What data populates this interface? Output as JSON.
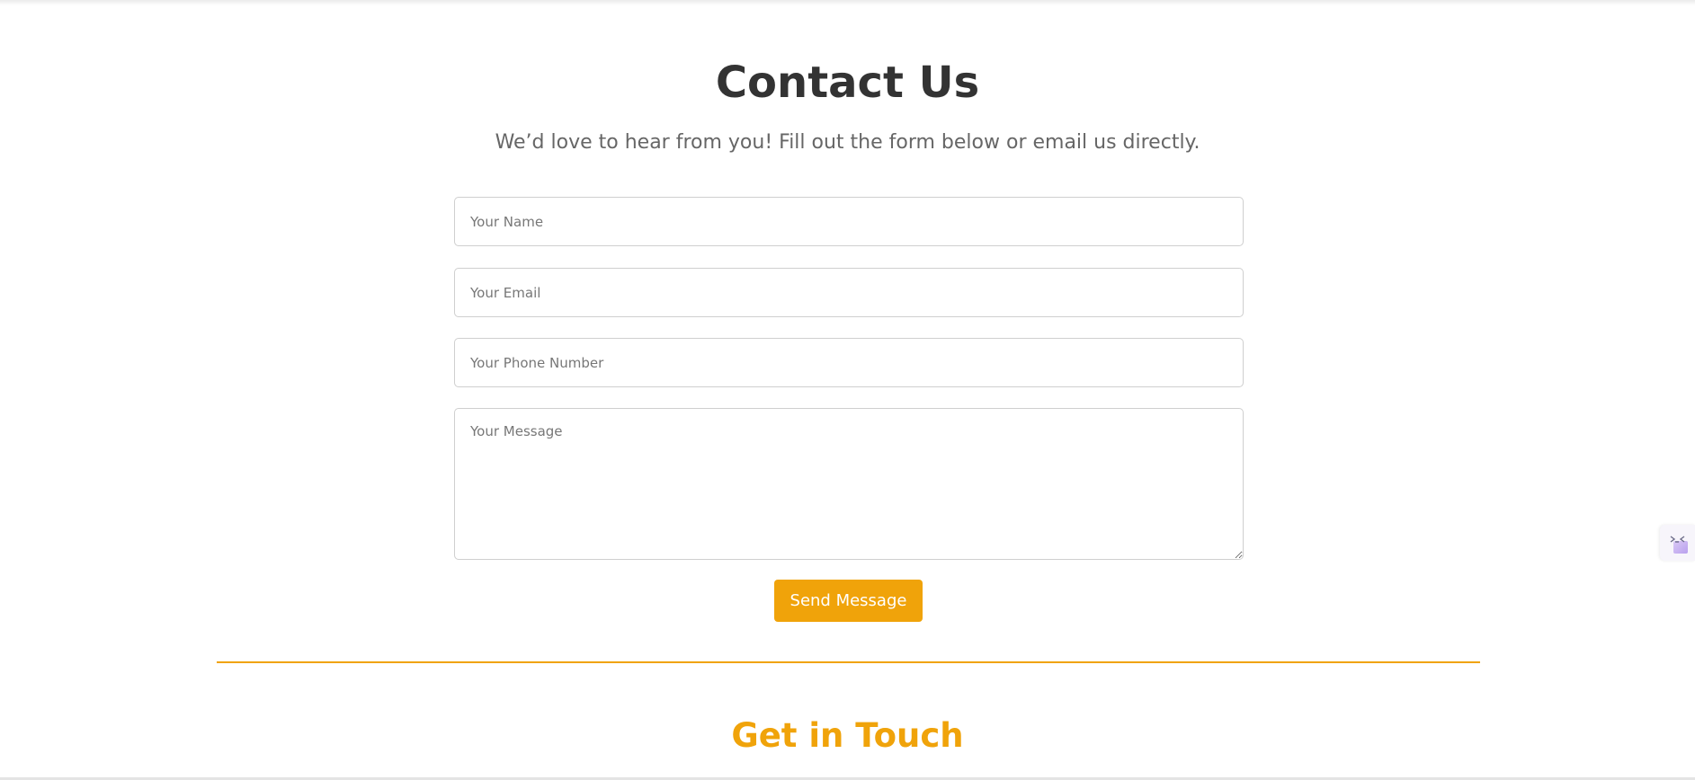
{
  "contact": {
    "title": "Contact Us",
    "subtitle": "We’d love to hear from you! Fill out the form below or email us directly.",
    "form": {
      "name_placeholder": "Your Name",
      "email_placeholder": "Your Email",
      "phone_placeholder": "Your Phone Number",
      "message_placeholder": "Your Message",
      "submit_label": "Send Message"
    }
  },
  "get_in_touch": {
    "heading": "Get in Touch"
  },
  "colors": {
    "accent": "#f0a30a",
    "heading_text": "#333333",
    "subtitle_text": "#666666",
    "field_border": "#cfcfcf"
  },
  "icons": {
    "side_widget": "extension-widget-icon"
  }
}
